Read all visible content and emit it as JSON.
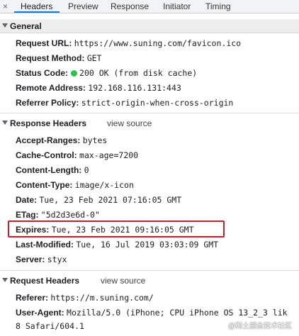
{
  "tabs": {
    "close": "×",
    "items": [
      "Headers",
      "Preview",
      "Response",
      "Initiator",
      "Timing"
    ]
  },
  "general": {
    "title": "General",
    "rows": [
      {
        "key": "Request URL:",
        "value": "https://www.suning.com/favicon.ico"
      },
      {
        "key": "Request Method:",
        "value": "GET"
      },
      {
        "key": "Status Code:",
        "value": "200 OK (from disk cache)"
      },
      {
        "key": "Remote Address:",
        "value": "192.168.116.131:443"
      },
      {
        "key": "Referrer Policy:",
        "value": "strict-origin-when-cross-origin"
      }
    ]
  },
  "response_headers": {
    "title": "Response Headers",
    "view_source": "view source",
    "rows": [
      {
        "key": "Accept-Ranges:",
        "value": "bytes"
      },
      {
        "key": "Cache-Control:",
        "value": "max-age=7200"
      },
      {
        "key": "Content-Length:",
        "value": "0"
      },
      {
        "key": "Content-Type:",
        "value": "image/x-icon"
      },
      {
        "key": "Date:",
        "value": "Tue, 23 Feb 2021 07:16:05 GMT"
      },
      {
        "key": "ETag:",
        "value": "\"5d2d3e6d-0\""
      },
      {
        "key": "Expires:",
        "value": "Tue, 23 Feb 2021 09:16:05 GMT"
      },
      {
        "key": "Last-Modified:",
        "value": "Tue, 16 Jul 2019 03:03:09 GMT"
      },
      {
        "key": "Server:",
        "value": "styx"
      }
    ]
  },
  "request_headers": {
    "title": "Request Headers",
    "view_source": "view source",
    "rows": [
      {
        "key": "Referer:",
        "value": "https://m.suning.com/"
      },
      {
        "key": "User-Agent:",
        "value": "Mozilla/5.0 (iPhone; CPU iPhone OS 13_2_3 lik"
      },
      {
        "key": "",
        "value": "8 Safari/604.1"
      }
    ]
  },
  "watermark": "@稀土掘金技术社区",
  "colors": {
    "status_dot": "#2fbf4a",
    "highlight": "#c8202a",
    "tab_active": "#1a73e8"
  }
}
